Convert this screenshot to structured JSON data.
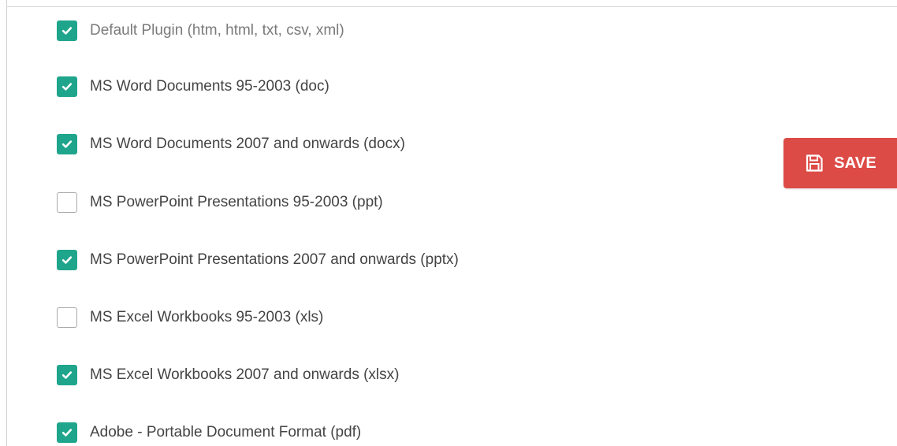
{
  "colors": {
    "checkbox_checked": "#1fa58c",
    "save_button": "#dd4b47"
  },
  "plugin_options": [
    {
      "label": "Default Plugin (htm, html, txt, csv, xml)",
      "checked": true,
      "muted": true
    },
    {
      "label": "MS Word Documents 95-2003 (doc)",
      "checked": true,
      "muted": false
    },
    {
      "label": "MS Word Documents 2007 and onwards (docx)",
      "checked": true,
      "muted": false
    },
    {
      "label": "MS PowerPoint Presentations 95-2003 (ppt)",
      "checked": false,
      "muted": false
    },
    {
      "label": "MS PowerPoint Presentations 2007 and onwards (pptx)",
      "checked": true,
      "muted": false
    },
    {
      "label": "MS Excel Workbooks 95-2003 (xls)",
      "checked": false,
      "muted": false
    },
    {
      "label": "MS Excel Workbooks 2007 and onwards (xlsx)",
      "checked": true,
      "muted": false
    },
    {
      "label": "Adobe - Portable Document Format (pdf)",
      "checked": true,
      "muted": false
    }
  ],
  "save_button": {
    "label": "SAVE",
    "icon": "floppy-disk-icon"
  }
}
